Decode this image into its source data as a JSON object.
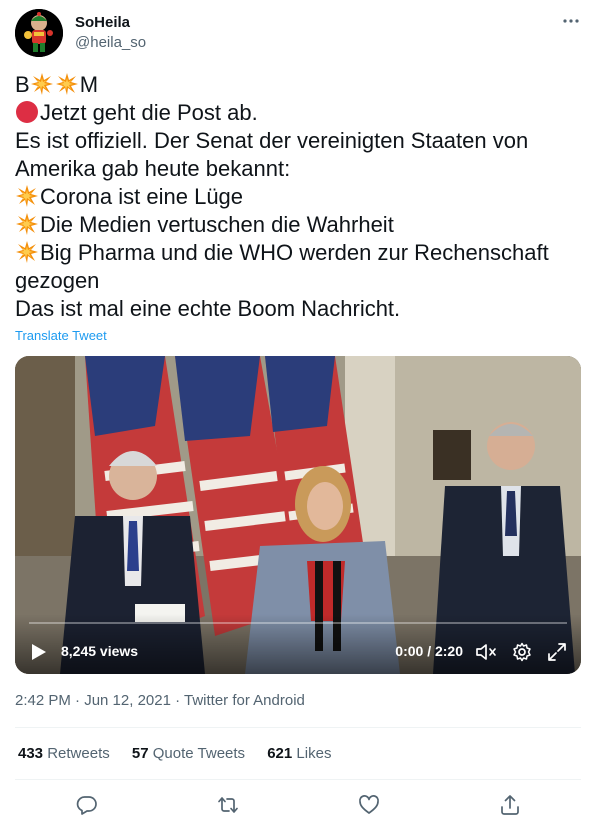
{
  "user": {
    "name": "SoHeila",
    "handle": "@heila_so"
  },
  "tweet": {
    "lines": [
      {
        "text": "B",
        "after": "M",
        "emojis": [
          "collision",
          "collision"
        ]
      },
      {
        "emoji": "red-circle",
        "text": "Jetzt geht die Post ab."
      },
      {
        "text": "Es ist offiziell. Der Senat der vereinigten Staaten von"
      },
      {
        "text": "Amerika gab heute bekannt:"
      },
      {
        "emoji": "collision",
        "text": "Corona ist eine Lüge"
      },
      {
        "emoji": "collision",
        "text": "Die Medien vertuschen die Wahrheit"
      },
      {
        "emoji": "collision",
        "text": "Big Pharma und die WHO werden zur Rechenschaft"
      },
      {
        "text": "gezogen"
      },
      {
        "text": "Das ist mal eine echte Boom Nachricht."
      }
    ],
    "translate_label": "Translate Tweet"
  },
  "video": {
    "views": "8,245 views",
    "time": "0:00 / 2:20",
    "progress": 0
  },
  "meta": {
    "timestamp": "2:42 PM · Jun 12, 2021 · Twitter for Android"
  },
  "stats": {
    "retweets_count": "433",
    "retweets_label": "Retweets",
    "quotes_count": "57",
    "quotes_label": "Quote Tweets",
    "likes_count": "621",
    "likes_label": "Likes"
  },
  "colors": {
    "accent": "#1d9bf0",
    "secondary_text": "#536471",
    "primary_text": "#0f1419"
  }
}
